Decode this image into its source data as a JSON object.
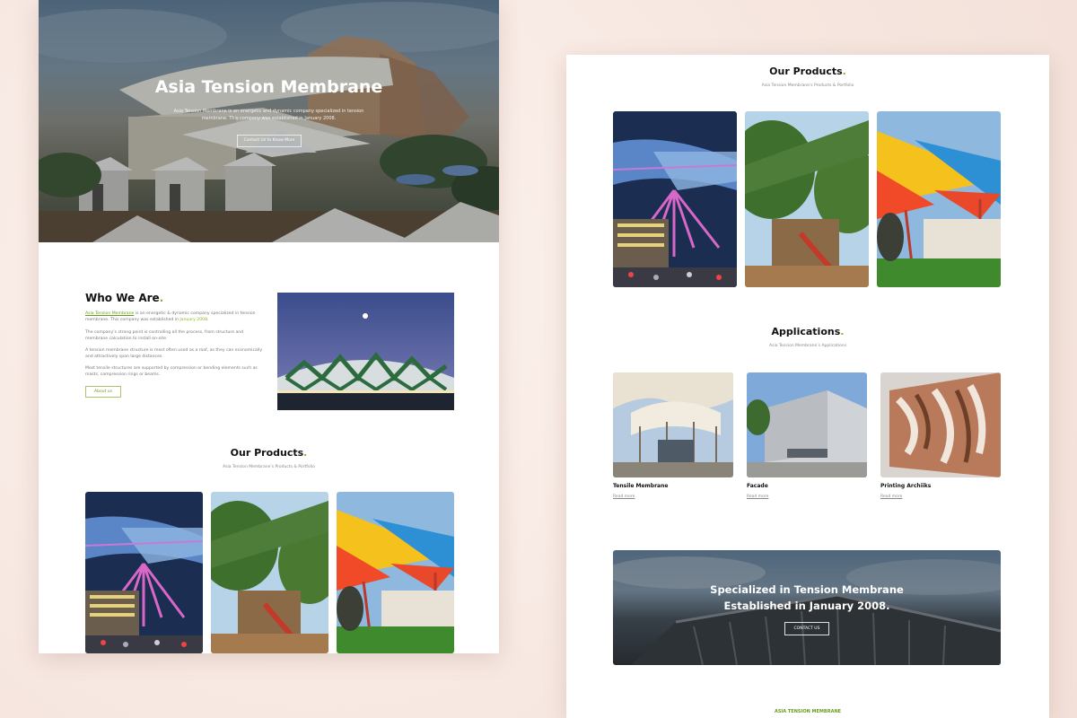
{
  "hero": {
    "title": "Asia Tension Membrane",
    "description": "Asia Tension Membrane is an energetic and dynamic company specialized in tension membrane. This company was established in January 2008.",
    "button_label": "Contact Us to Know More"
  },
  "who": {
    "title": "Who We Are",
    "title_dot": ".",
    "p1_link": "Asia Tension Membrane",
    "p1_text": " is an energetic & dynamic company specialized in tension membrane. This company was established in ",
    "p1_date": "January 2008",
    "p1_end": ".",
    "p2": "The company’s strong point is controlling all the process, from structure and membrane calculation to install on-site.",
    "p3": "A tension membrane structure is most often used as a roof, as they can economically and attractively span large distances.",
    "p4": "Most tensile structures are supported by compression or bending elements such as masts, compression rings or beams.",
    "button_label": "About us"
  },
  "products": {
    "title": "Our Products",
    "title_dot": ".",
    "subtitle": "Asia Tension Membrane’s Products & Portfolio"
  },
  "applications": {
    "title": "Applications",
    "title_dot": ".",
    "subtitle": "Asia Tension Membrane’s Applications",
    "items": [
      {
        "name": "Tensile Membrane",
        "link": "Read more"
      },
      {
        "name": "Facade",
        "link": "Read more"
      },
      {
        "name": "Printing Archiiks",
        "link": "Read more"
      }
    ]
  },
  "cta": {
    "line1": "Specialized in Tension Membrane",
    "line2": "Established in January 2008.",
    "button_label": "CONTACT US"
  },
  "footer": {
    "brand": "ASIA TENSION MEMBRANE"
  },
  "colors": {
    "accent": "#8ab624",
    "page_background": "#f7ebe6"
  }
}
